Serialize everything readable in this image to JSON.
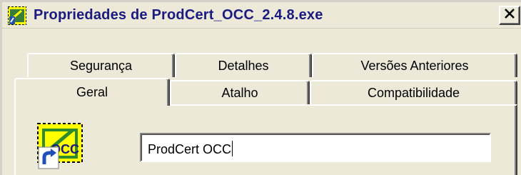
{
  "window": {
    "title": "Propriedades de ProdCert_OCC_2.4.8.exe",
    "title_icon": "properties-icon",
    "close_icon": "close-icon"
  },
  "tabs": {
    "row1": [
      {
        "label": "Segurança"
      },
      {
        "label": "Detalhes"
      },
      {
        "label": "Versões Anteriores"
      }
    ],
    "row2": [
      {
        "label": "Geral",
        "active": true
      },
      {
        "label": "Atalho"
      },
      {
        "label": "Compatibilidade"
      }
    ]
  },
  "general": {
    "app_icon": "shortcut-app-icon",
    "app_icon_text": "OCC",
    "name_value": "ProdCert OCC"
  },
  "colors": {
    "title_text": "#1a1a80",
    "face": "#ece9d8",
    "icon_yellow": "#ffff00",
    "icon_green": "#2e8b2e",
    "shortcut_arrow": "#1f4fb8"
  }
}
